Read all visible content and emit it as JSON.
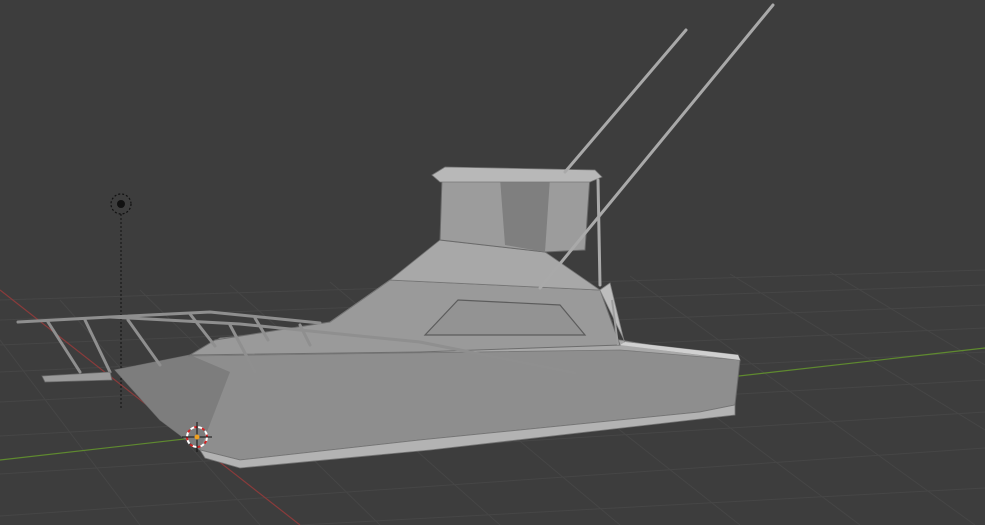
{
  "viewport": {
    "background": "#3d3d3d",
    "grid_color": "#474747",
    "x_axis_color": "#8a3b3b",
    "y_axis_color": "#5f8a2f",
    "model_body_color": "#8c8c8c",
    "model_light_color": "#a6a6a6",
    "model_dark_color": "#6e6e6e",
    "icons": {
      "light": "point-light-icon",
      "cursor": "3d-cursor-icon"
    }
  }
}
